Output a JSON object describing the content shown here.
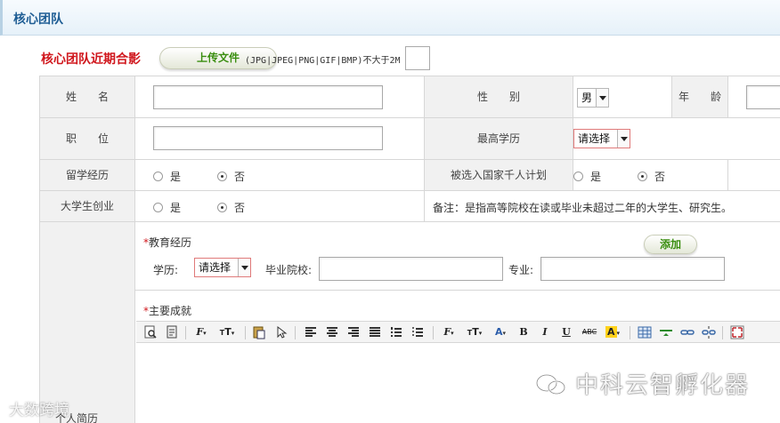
{
  "header": {
    "title": "核心团队"
  },
  "photo": {
    "label": "核心团队近期合影",
    "upload_button": "上传文件",
    "hint": "(JPG|JPEG|PNG|GIF|BMP)不大于2M"
  },
  "form": {
    "name_label": "姓　　名",
    "gender_label": "性　　别",
    "gender_value": "男",
    "age_label": "年　　龄",
    "position_label": "职　　位",
    "education_label": "最高学历",
    "education_value": "请选择",
    "study_abroad_label": "留学经历",
    "thousand_talents_label": "被选入国家千人计划",
    "student_startup_label": "大学生创业",
    "yes": "是",
    "no": "否",
    "note": "备注：是指高等院校在读或毕业未超过二年的大学生、研究生。"
  },
  "education": {
    "title": "教育经历",
    "add_button": "添加",
    "degree_label": "学历:",
    "degree_value": "请选择",
    "school_label": "毕业院校:",
    "major_label": "专业:"
  },
  "achievements": {
    "title": "主要成就"
  },
  "resume_label": "个人简历",
  "watermark": {
    "main": "中科云智孵化器",
    "small": "大数跨境"
  }
}
